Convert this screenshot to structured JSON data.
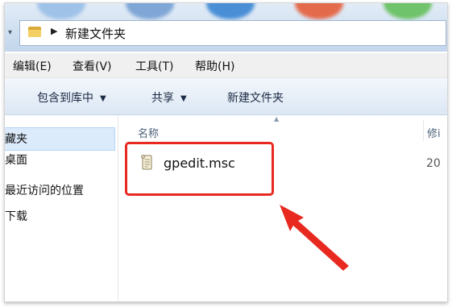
{
  "address_bar": {
    "path_text": "新建文件夹"
  },
  "menu": {
    "items": [
      {
        "label": "编辑(E)"
      },
      {
        "label": "查看(V)"
      },
      {
        "label": "工具(T)"
      },
      {
        "label": "帮助(H)"
      }
    ]
  },
  "toolbar": {
    "include_in_library": "包含到库中",
    "share": "共享",
    "new_folder": "新建文件夹"
  },
  "navigation": {
    "items": [
      {
        "label": "藏夹"
      },
      {
        "label": "桌面"
      },
      {
        "label": "最近访问的位置"
      },
      {
        "label": "下载"
      }
    ]
  },
  "file_list": {
    "columns": [
      {
        "label": "名称"
      },
      {
        "label": "修i"
      }
    ],
    "files": [
      {
        "name": "gpedit.msc",
        "date": "20"
      }
    ]
  },
  "colors": {
    "annotation": "#e8291f",
    "selection": "#dcebfc",
    "toolbar_gradient_top": "#f3f7fc",
    "toolbar_gradient_bottom": "#dce7f4"
  },
  "icons": {
    "address_folder": "folder-icon",
    "file": "scroll-document-icon",
    "annotation_arrow": "red-arrow-icon"
  }
}
